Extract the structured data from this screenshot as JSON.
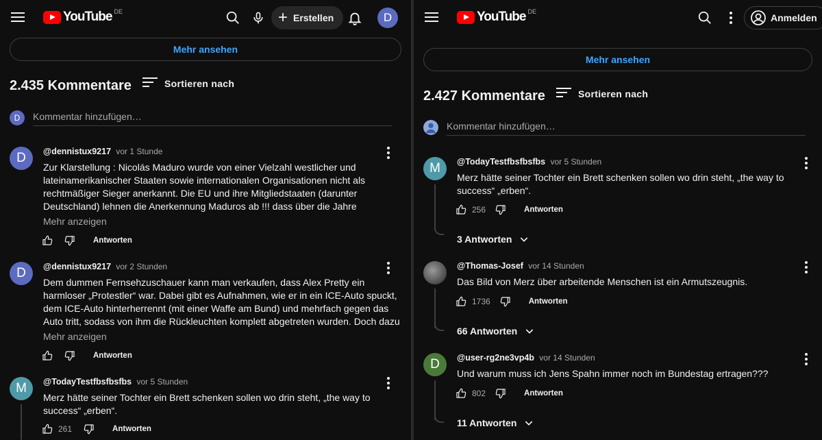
{
  "colors": {
    "bg": "#0f0f0f",
    "link": "#3ea6ff",
    "brand": "#ff0000",
    "muted": "#aaaaaa"
  },
  "left": {
    "header": {
      "logo_text": "YouTube",
      "logo_country": "DE",
      "create_label": "Erstellen",
      "avatar_letter": "D",
      "icons": [
        "menu-icon",
        "search-icon",
        "microphone-icon",
        "plus-icon",
        "bell-icon"
      ]
    },
    "more_label": "Mehr ansehen",
    "comment_count": "2.435 Kommentare",
    "sort_label": "Sortieren nach",
    "add_comment": {
      "avatar_letter": "D",
      "placeholder": "Kommentar hinzufügen…"
    },
    "comments": [
      {
        "avatar_letter": "D",
        "author": "@dennistux9217",
        "time": "vor 1 Stunde",
        "text": "Zur Klarstellung : Nicolás Maduro wurde von einer Vielzahl westlicher und lateinamerikanischer Staaten sowie internationalen Organisationen nicht als rechtmäßiger Sieger anerkannt. Die EU und ihre Mitgliedstaaten (darunter Deutschland) lehnen die Anerkennung Maduros ab !!!  dass über die Jahre Dutzende Milliarden US-",
        "more_label": "Mehr anzeigen",
        "likes": "",
        "reply_label": "Antworten"
      },
      {
        "avatar_letter": "D",
        "author": "@dennistux9217",
        "time": "vor 2 Stunden",
        "text": "Dem dummen Fernsehzuschauer kann man verkaufen, dass Alex Pretty ein harmloser „Protestler“ war. Dabei gibt es Aufnahmen, wie er in ein ICE-Auto spuckt, dem ICE-Auto hinterherrennt (mit einer Waffe am Bund) und mehrfach gegen das Auto tritt, sodass von ihm die Rückleuchten komplett abgetreten wurden. Doch dazu kein Wort? Kein Wunder, …",
        "more_label": "Mehr anzeigen",
        "likes": "",
        "reply_label": "Antworten"
      },
      {
        "avatar_letter": "M",
        "author": "@TodayTestfbsfbsfbs",
        "time": "vor 5 Stunden",
        "text": "Merz hätte seiner Tochter ein Brett schenken sollen wo drin steht, „the way to success“ „erben“.",
        "likes": "261",
        "reply_label": "Antworten"
      }
    ]
  },
  "right": {
    "header": {
      "logo_text": "YouTube",
      "logo_country": "DE",
      "signin_label": "Anmelden",
      "icons": [
        "menu-icon",
        "search-icon",
        "kebab-icon",
        "account-icon"
      ]
    },
    "more_label": "Mehr ansehen",
    "comment_count": "2.427 Kommentare",
    "sort_label": "Sortieren nach",
    "add_comment": {
      "placeholder": "Kommentar hinzufügen…"
    },
    "comments": [
      {
        "avatar_letter": "M",
        "author": "@TodayTestfbsfbsfbs",
        "time": "vor 5 Stunden",
        "text": "Merz hätte seiner Tochter ein Brett schenken sollen wo drin steht, „the way to success“ „erben“.",
        "likes": "256",
        "reply_label": "Antworten",
        "replies_label": "3 Antworten"
      },
      {
        "avatar_letter": "",
        "author": "@Thomas-Josef",
        "time": "vor 14 Stunden",
        "text": "Das Bild von Merz über arbeitende Menschen ist ein Armutszeugnis.",
        "likes": "1736",
        "reply_label": "Antworten",
        "replies_label": "66 Antworten"
      },
      {
        "avatar_letter": "D",
        "author": "@user-rg2ne3vp4b",
        "time": "vor 14 Stunden",
        "text": "Und warum muss ich Jens Spahn immer noch im Bundestag ertragen???",
        "likes": "802",
        "reply_label": "Antworten",
        "replies_label": "11 Antworten"
      }
    ]
  }
}
